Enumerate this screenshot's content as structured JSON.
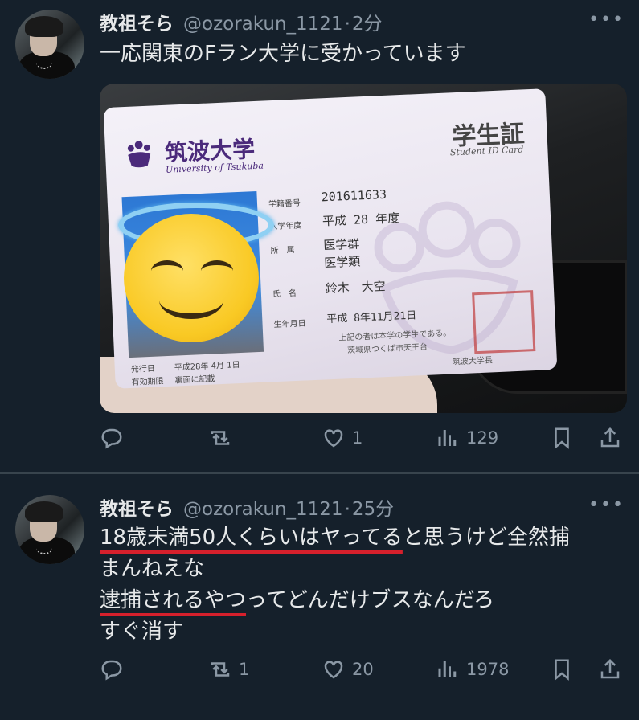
{
  "tweets": [
    {
      "author": {
        "name": "教祖そら",
        "handle": "@ozorakun_1121"
      },
      "separator": "·",
      "time": "2分",
      "text_lines": [
        "一応関東のFラン大学に受かっています"
      ],
      "media": {
        "card": {
          "university_jp": "筑波大学",
          "university_en": "University of Tsukuba",
          "title": "学生証",
          "subtitle": "Student ID Card",
          "student_no_label": "学籍番号",
          "student_no": "201611633",
          "entry_year_label": "入学年度",
          "entry_year": "平成 28 年度",
          "affiliation_label": "所　属",
          "affiliation_1": "医学群",
          "affiliation_2": "医学類",
          "name_label": "氏　名",
          "name": "鈴木　大空",
          "dob_label": "生年月日",
          "dob": "平成 8年11月21日",
          "note_1": "上記の者は本学の学生である。",
          "note_2": "茨城県つくば市天王台",
          "issue_label": "発行日",
          "issue_date": "平成28年 4月 1日",
          "validity_label": "有効期限",
          "validity": "裏面に記載",
          "signature": "筑波大学長"
        }
      },
      "stats": {
        "replies": "",
        "retweets": "",
        "likes": "1",
        "views": "129"
      }
    },
    {
      "author": {
        "name": "教祖そら",
        "handle": "@ozorakun_1121"
      },
      "separator": "·",
      "time": "25分",
      "text": {
        "l1_underlined": "18歳未満50人くらいはヤってる",
        "l1_rest": "と思うけど全然捕",
        "l2": "まんねえな",
        "l3_underlined": "逮捕されるやつ",
        "l3_rest": "ってどんだけブスなんだろ",
        "l4": "すぐ消す"
      },
      "stats": {
        "replies": "",
        "retweets": "1",
        "likes": "20",
        "views": "1978"
      }
    }
  ],
  "colors": {
    "background": "#15202b",
    "text": "#e7e9ea",
    "muted": "#8b98a5",
    "divider": "#38444d",
    "underline": "#d6202c"
  },
  "icons": [
    "reply-icon",
    "retweet-icon",
    "like-icon",
    "views-icon",
    "bookmark-icon",
    "share-icon",
    "more-icon"
  ]
}
